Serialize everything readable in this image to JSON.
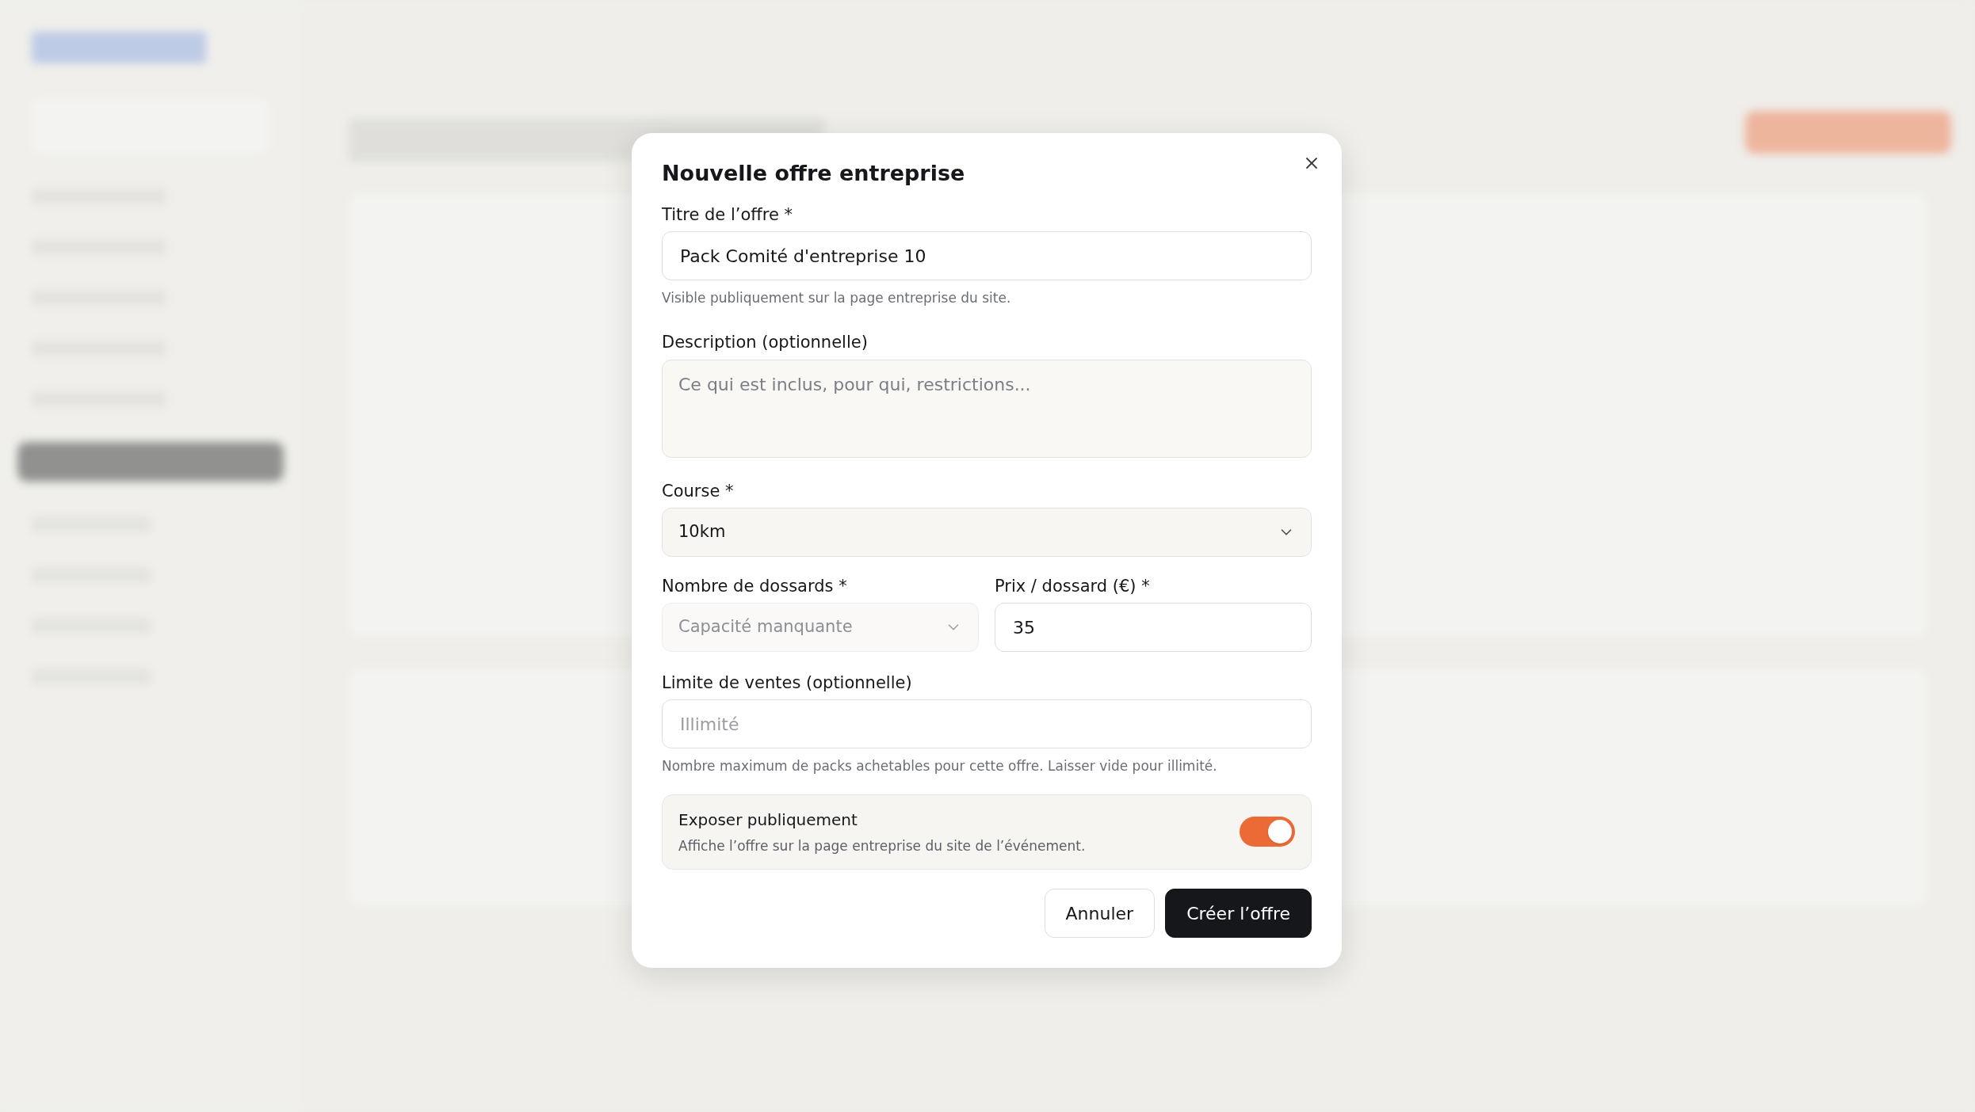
{
  "dialog": {
    "title": "Nouvelle offre entreprise",
    "title_field": {
      "label": "Titre de l’offre *",
      "value": "Pack Comité d'entreprise 10",
      "help": "Visible publiquement sur la page entreprise du site."
    },
    "description_field": {
      "label": "Description (optionnelle)",
      "placeholder": "Ce qui est inclus, pour qui, restrictions..."
    },
    "course_field": {
      "label": "Course *",
      "value": "10km",
      "disabled": false
    },
    "bibs_field": {
      "label": "Nombre de dossards *",
      "placeholder": "Capacité manquante",
      "disabled": true
    },
    "price_field": {
      "label": "Prix / dossard (€) *",
      "value": "35"
    },
    "limit_field": {
      "label": "Limite de ventes (optionnelle)",
      "placeholder": "Illimité",
      "help": "Nombre maximum de packs achetables pour cette offre. Laisser vide pour illimité."
    },
    "public_toggle": {
      "label": "Exposer publiquement",
      "description": "Affiche l’offre sur la page entreprise du site de l’événement.",
      "on": true
    },
    "buttons": [
      {
        "label": "Annuler",
        "kind": "secondary"
      },
      {
        "label": "Créer l’offre",
        "kind": "primary"
      }
    ]
  }
}
